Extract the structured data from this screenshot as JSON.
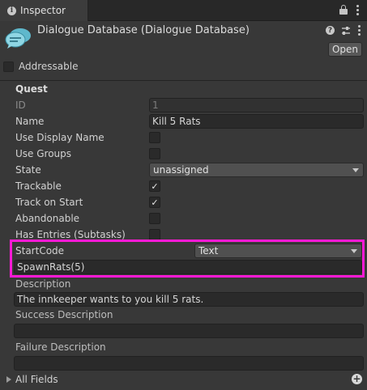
{
  "tab": {
    "title": "Inspector",
    "icon": "info-icon"
  },
  "header": {
    "title": "Dialogue Database (Dialogue Database)",
    "open_label": "Open",
    "addressable_label": "Addressable"
  },
  "quest": {
    "section_title": "Quest",
    "id_label": "ID",
    "id_value": "1",
    "name_label": "Name",
    "name_value": "Kill 5 Rats",
    "use_display_name_label": "Use Display Name",
    "use_display_name_checked": false,
    "use_groups_label": "Use Groups",
    "use_groups_checked": false,
    "state_label": "State",
    "state_value": "unassigned",
    "trackable_label": "Trackable",
    "trackable_checked": true,
    "track_on_start_label": "Track on Start",
    "track_on_start_checked": true,
    "abandonable_label": "Abandonable",
    "abandonable_checked": false,
    "has_entries_label": "Has Entries (Subtasks)",
    "has_entries_checked": false,
    "start_code_label": "StartCode",
    "start_code_type": "Text",
    "start_code_value": "SpawnRats(5)",
    "description_label": "Description",
    "description_value": "The innkeeper wants to you kill 5 rats.",
    "success_label": "Success Description",
    "success_value": "",
    "failure_label": "Failure Description",
    "failure_value": ""
  },
  "footer": {
    "all_fields_label": "All Fields"
  },
  "colors": {
    "highlight": "#ff1ad6",
    "background": "#383838"
  }
}
